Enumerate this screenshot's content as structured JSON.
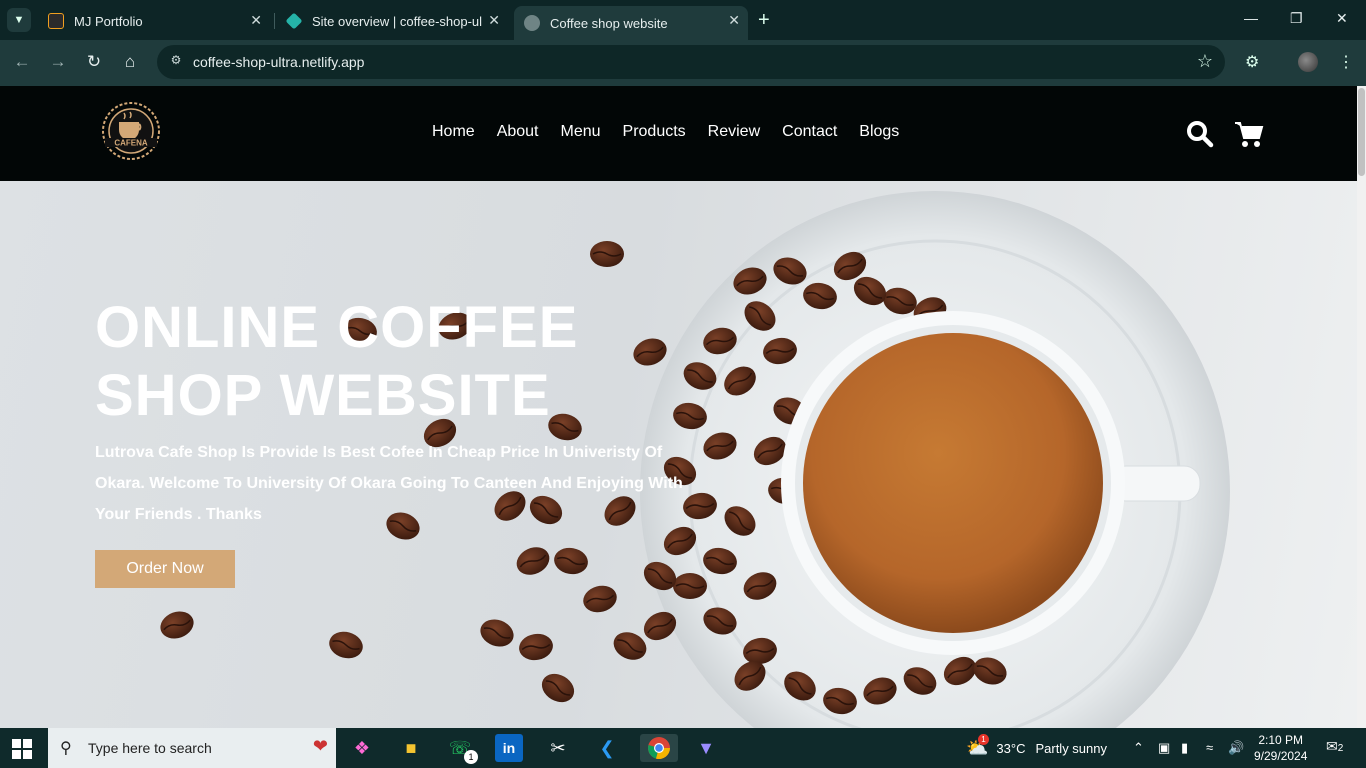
{
  "browser": {
    "tabs": [
      {
        "title": "MJ Portfolio",
        "icon": "mj-logo-icon"
      },
      {
        "title": "Site overview | coffee-shop-ultr",
        "icon": "netlify-icon"
      },
      {
        "title": "Coffee shop website",
        "icon": "globe-icon"
      }
    ],
    "active_tab": 2,
    "url": "coffee-shop-ultra.netlify.app"
  },
  "site": {
    "logo_text": "CAFENA",
    "nav": [
      "Home",
      "About",
      "Menu",
      "Products",
      "Review",
      "Contact",
      "Blogs"
    ],
    "hero": {
      "title_line1": "ONLINE COFFEE",
      "title_line2": "SHOP WEBSITE",
      "text": "Lutrova Cafe Shop Is Provide Is Best Cofee In Cheap Price In Univeristy Of Okara. Welcome To University Of Okara Going To Canteen And Enjoying With Your Friends . Thanks",
      "button": "Order Now"
    },
    "accent": "#d3a877"
  },
  "taskbar": {
    "search_placeholder": "Type here to search",
    "whatsapp_badge": "1",
    "weather_badge": "1",
    "temperature": "33°C",
    "weather": "Partly sunny",
    "time": "2:10 PM",
    "date": "9/29/2024",
    "notifications": "2"
  }
}
